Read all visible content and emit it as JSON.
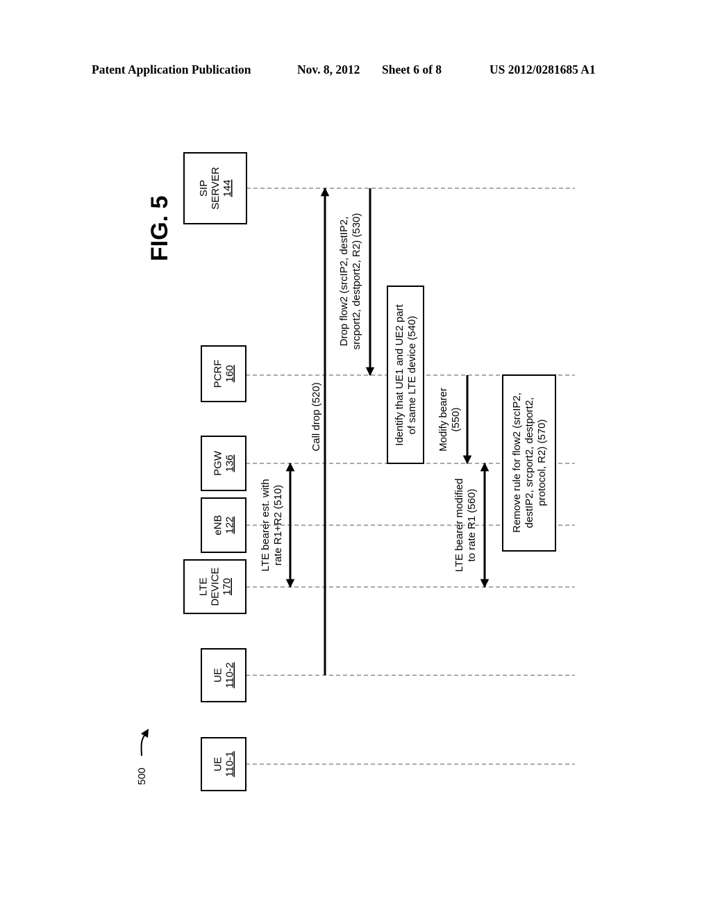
{
  "header": {
    "publication": "Patent Application Publication",
    "date": "Nov. 8, 2012",
    "sheet": "Sheet 6 of 8",
    "number": "US 2012/0281685 A1"
  },
  "figure": {
    "title": "FIG. 5",
    "reference": "500"
  },
  "entities": [
    {
      "id": "sip",
      "name_lines": [
        "SIP",
        "SERVER"
      ],
      "ref": "144"
    },
    {
      "id": "pcrf",
      "name_lines": [
        "PCRF"
      ],
      "ref": "160"
    },
    {
      "id": "pgw",
      "name_lines": [
        "PGW"
      ],
      "ref": "136"
    },
    {
      "id": "enb",
      "name_lines": [
        "eNB"
      ],
      "ref": "122"
    },
    {
      "id": "lte",
      "name_lines": [
        "LTE",
        "DEVICE"
      ],
      "ref": "170"
    },
    {
      "id": "ue2",
      "name_lines": [
        "UE"
      ],
      "ref": "110-2"
    },
    {
      "id": "ue1",
      "name_lines": [
        "UE"
      ],
      "ref": "110-1"
    }
  ],
  "messages": [
    {
      "id": "510",
      "type": "bidirectional",
      "from": "pgw",
      "to": "lte",
      "lines": [
        "LTE bearer est. with",
        "rate R1+R2 (510)"
      ]
    },
    {
      "id": "520",
      "type": "arrow",
      "from": "ue2",
      "to": "sip",
      "lines": [
        "Call drop (520)"
      ]
    },
    {
      "id": "530",
      "type": "arrow",
      "from": "sip",
      "to": "pcrf",
      "lines": [
        "Drop flow2 (srcIP2, destIP2,",
        "srcport2, destport2, R2) (530)"
      ]
    },
    {
      "id": "540",
      "type": "action",
      "at": "pcrf",
      "lines": [
        "Identify that UE1 and UE2 part",
        "of same LTE device (540)"
      ]
    },
    {
      "id": "550",
      "type": "arrow",
      "from": "pcrf",
      "to": "pgw",
      "lines": [
        "Modify bearer",
        "(550)"
      ]
    },
    {
      "id": "560",
      "type": "bidirectional",
      "from": "pgw",
      "to": "lte",
      "lines": [
        "LTE bearer modified",
        "to rate R1 (560)"
      ]
    },
    {
      "id": "570",
      "type": "action",
      "at": "pcrf",
      "lines": [
        "Remove rule for flow2 (srcIP2,",
        "destIP2, srcport2, destport2,",
        "protocol, R2) (570)"
      ]
    }
  ]
}
